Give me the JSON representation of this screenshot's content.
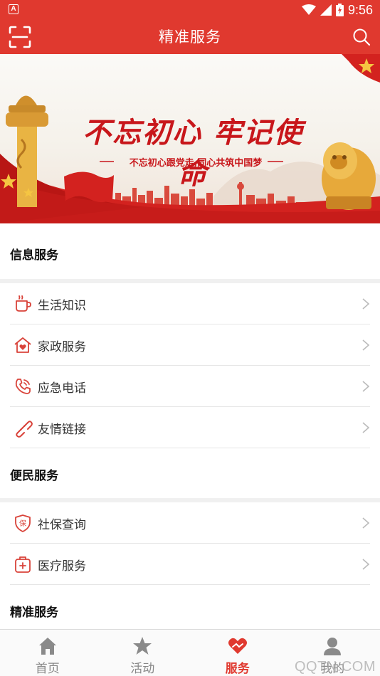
{
  "status_bar": {
    "left_badge": "A",
    "time": "9:56"
  },
  "app_bar": {
    "title": "精准服务"
  },
  "banner": {
    "title": "不忘初心  牢记使命",
    "subtitle": "不忘初心跟党走,同心共筑中国梦"
  },
  "sections": [
    {
      "title": "信息服务",
      "items": [
        {
          "label": "生活知识",
          "icon": "cup-icon"
        },
        {
          "label": "家政服务",
          "icon": "home-heart-icon"
        },
        {
          "label": "应急电话",
          "icon": "phone-icon"
        },
        {
          "label": "友情链接",
          "icon": "link-icon"
        }
      ]
    },
    {
      "title": "便民服务",
      "items": [
        {
          "label": "社保查询",
          "icon": "shield-icon"
        },
        {
          "label": "医疗服务",
          "icon": "medical-kit-icon"
        }
      ]
    },
    {
      "title": "精准服务",
      "items": []
    }
  ],
  "bottom_nav": {
    "items": [
      {
        "label": "首页",
        "icon": "home-icon"
      },
      {
        "label": "活动",
        "icon": "star-icon"
      },
      {
        "label": "服务",
        "icon": "heart-hand-icon",
        "active": true
      },
      {
        "label": "我的",
        "icon": "user-icon"
      }
    ]
  },
  "watermark": "QQTN.COM",
  "colors": {
    "primary": "#e0392f",
    "icon": "#d9433a",
    "divider": "#e6e6e6"
  }
}
